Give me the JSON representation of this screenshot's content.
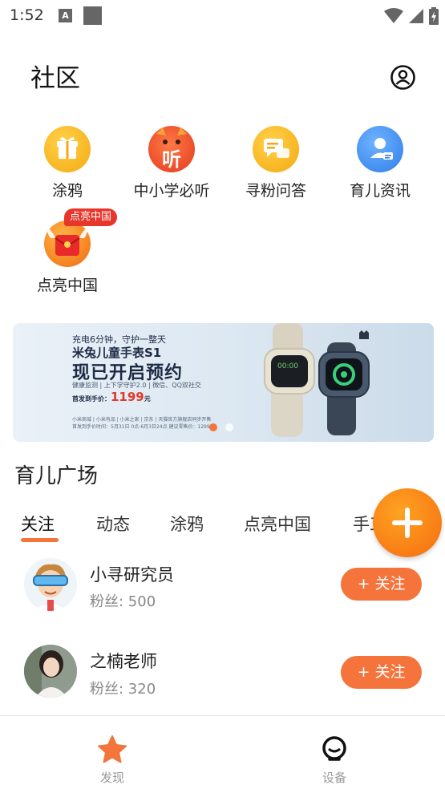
{
  "status_bar": {
    "time": "1:52",
    "notification_badge": "A"
  },
  "header": {
    "title": "社区",
    "profile_icon": "user-circle-icon"
  },
  "features": [
    {
      "label": "涂鸦",
      "icon": "gift-icon",
      "color": "#f9b31b"
    },
    {
      "label": "中小学必听",
      "icon": "listen-mascot-icon",
      "color": "#ef4e24",
      "icon_text": "听"
    },
    {
      "label": "寻粉问答",
      "icon": "chat-bubbles-icon",
      "color": "#f9b31b"
    },
    {
      "label": "育儿资讯",
      "icon": "profile-card-icon",
      "color": "#3b8df0"
    },
    {
      "label": "点亮中国",
      "icon": "red-envelope-icon",
      "color": "#f97c1f",
      "badge": "点亮中国"
    }
  ],
  "banner": {
    "line1": "充电6分钟，守护一整天",
    "line2": "米兔儿童手表S1",
    "line3": "现已开启预约",
    "line4": "健康监测 | 上下学守护2.0 | 微信、QQ双社交",
    "price_label": "首发到手价：",
    "price_value": "1199",
    "price_unit": "元",
    "line6": "小米商城 | 小米有品 | 小米之家 | 京东 | 天猫官方旗舰店同步开售",
    "line7": "首发到手价时间：5月31日 0点-6月3日24点  建议零售价：1299元",
    "current_slide": 1,
    "slide_count": 2
  },
  "section": {
    "title": "育儿广场"
  },
  "tabs": {
    "items": [
      "关注",
      "动态",
      "涂鸦",
      "点亮中国",
      "手工"
    ],
    "active_index": 0
  },
  "users": [
    {
      "name": "小寻研究员",
      "fans": "粉丝: 500",
      "follow_label": "+ 关注"
    },
    {
      "name": "之楠老师",
      "fans": "粉丝: 320",
      "follow_label": "+ 关注"
    }
  ],
  "bottom_nav": {
    "items": [
      {
        "label": "发现",
        "icon": "star-icon",
        "active": true
      },
      {
        "label": "设备",
        "icon": "watch-face-icon",
        "active": false
      }
    ]
  },
  "colors": {
    "accent": "#f4743b",
    "fab": "#f56c10",
    "nav_active": "#f4743b",
    "nav_inactive": "#999999"
  }
}
